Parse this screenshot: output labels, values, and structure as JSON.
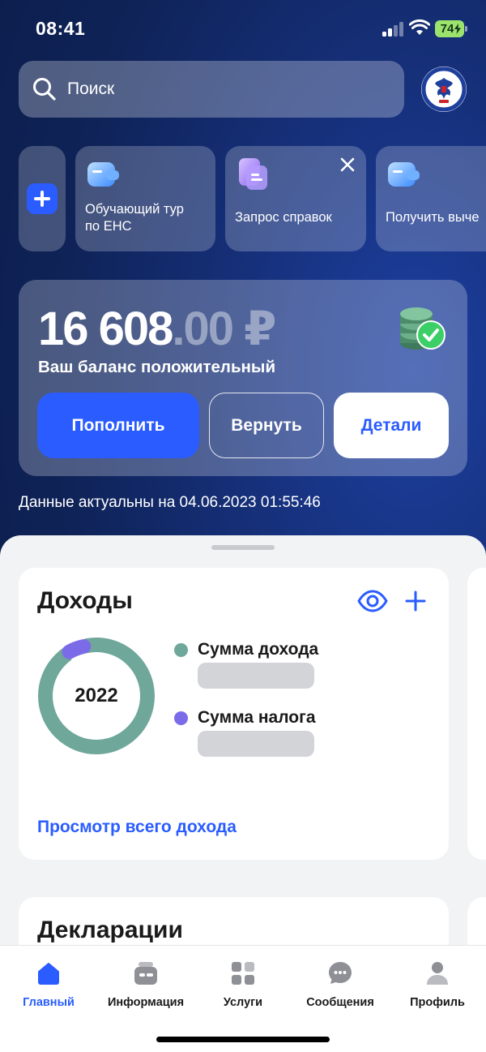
{
  "status_bar": {
    "time": "08:41",
    "battery": "74"
  },
  "search": {
    "placeholder": "Поиск"
  },
  "quick_actions": [
    {
      "label": "Обучающий тур\nпо ЕНС",
      "icon": "wallet-icon"
    },
    {
      "label": "Запрос справок",
      "icon": "document-icon"
    },
    {
      "label": "Получить выче",
      "icon": "wallet-icon"
    }
  ],
  "balance": {
    "amount_int": "16 608",
    "amount_dec": ".00 ₽",
    "status": "Ваш баланс положительный",
    "topup_label": "Пополнить",
    "return_label": "Вернуть",
    "details_label": "Детали",
    "data_date": "Данные актуальны на 04.06.2023 01:55:46"
  },
  "income": {
    "title": "Доходы",
    "year": "2022",
    "legend": [
      {
        "label": "Сумма дохода",
        "color": "#6fa79a"
      },
      {
        "label": "Сумма налога",
        "color": "#7b6be8"
      }
    ],
    "link": "Просмотр всего дохода"
  },
  "declarations": {
    "title": "Декларации"
  },
  "tabs": [
    {
      "label": "Главный",
      "icon": "home-icon",
      "active": true
    },
    {
      "label": "Информация",
      "icon": "info-box-icon",
      "active": false
    },
    {
      "label": "Услуги",
      "icon": "grid-icon",
      "active": false
    },
    {
      "label": "Сообщения",
      "icon": "chat-icon",
      "active": false
    },
    {
      "label": "Профиль",
      "icon": "profile-icon",
      "active": false
    }
  ],
  "colors": {
    "accent": "#2a5cff",
    "income": "#6fa79a",
    "tax": "#7b6be8"
  }
}
